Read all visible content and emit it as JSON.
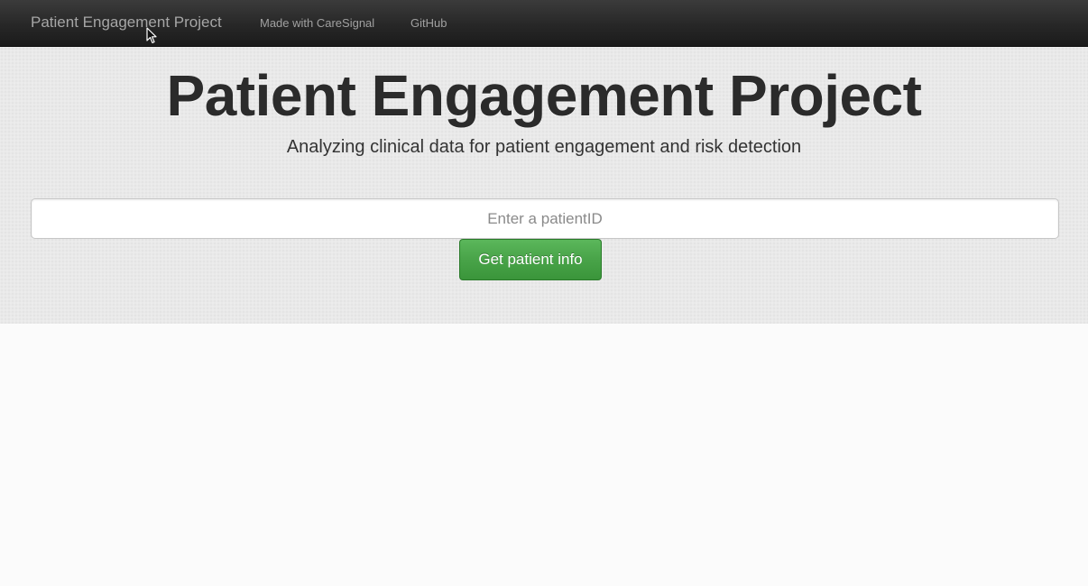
{
  "navbar": {
    "brand": "Patient Engagement Project",
    "links": [
      {
        "label": "Made with CareSignal"
      },
      {
        "label": "GitHub"
      }
    ]
  },
  "hero": {
    "title": "Patient Engagement Project",
    "subtitle": "Analyzing clinical data for patient engagement and risk detection"
  },
  "search": {
    "value": "",
    "placeholder": "Enter a patientID",
    "button_label": "Get patient info"
  },
  "colors": {
    "navbar_bg": "#272727",
    "button_green": "#4aa54a",
    "page_bg": "#fbfbfb"
  },
  "icons": {
    "cursor": "mouse-pointer-icon"
  }
}
